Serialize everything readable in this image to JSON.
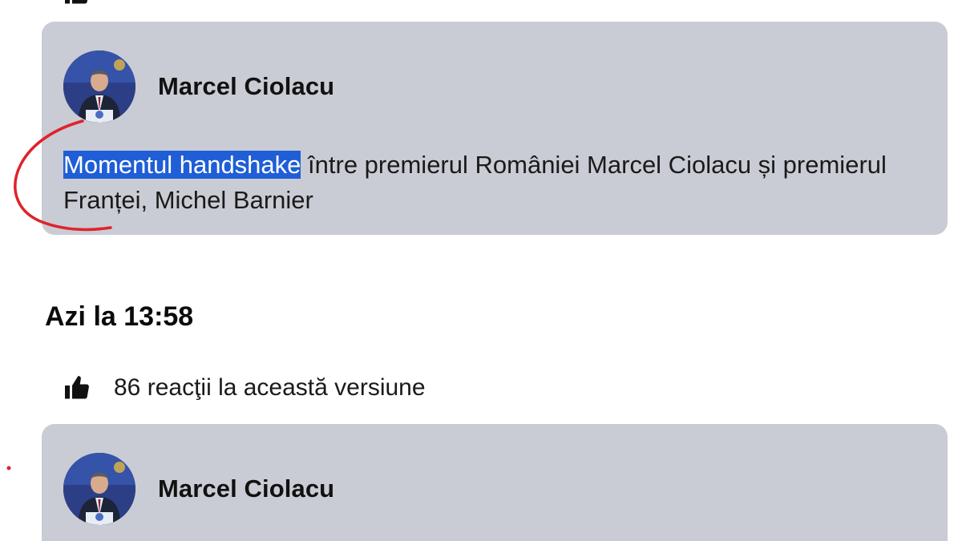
{
  "first_post": {
    "author": "Marcel Ciolacu",
    "text_highlighted": "Momentul handshake",
    "text_rest": " între premierul României Marcel Ciolacu și premierul Franței, Michel Barnier"
  },
  "version": {
    "time": "Azi la 13:58",
    "reactions": "86 reacţii la această versiune"
  },
  "second_post": {
    "author": "Marcel Ciolacu"
  },
  "colors": {
    "card_background": "#c9ccd4",
    "highlight": "#1f5ed6",
    "annotation": "#e0222b"
  },
  "icons": [
    "like-icon",
    "avatar"
  ]
}
